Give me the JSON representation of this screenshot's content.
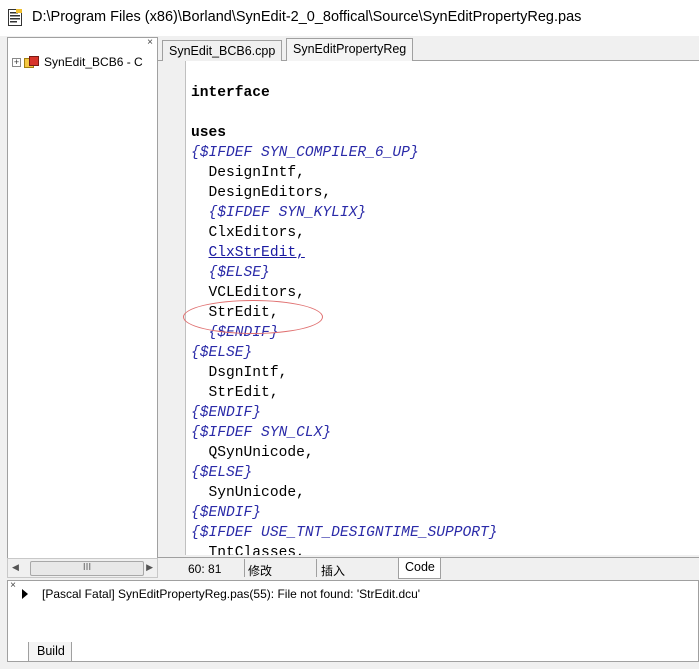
{
  "window": {
    "title": "D:\\Program Files (x86)\\Borland\\SynEdit-2_0_8offical\\Source\\SynEditPropertyReg.pas"
  },
  "project_tree": {
    "close_glyph": "×",
    "items": [
      {
        "label": "SynEdit_BCB6 - C",
        "expander": "+",
        "icon": "project-icon"
      }
    ]
  },
  "scrollbar": {
    "left_arrow": "◀",
    "right_arrow": "▶",
    "thumb_grip": "III"
  },
  "tabs": [
    {
      "label": "SynEdit_BCB6.cpp",
      "active": false
    },
    {
      "label": "SynEditPropertyReg",
      "active": true
    }
  ],
  "code_lines": [
    {
      "text": "interface",
      "style": "kw"
    },
    {
      "text": "",
      "style": "id"
    },
    {
      "text": "uses",
      "style": "kw"
    },
    {
      "text": "{$IFDEF SYN_COMPILER_6_UP}",
      "style": "dir"
    },
    {
      "text": "  DesignIntf,",
      "style": "id"
    },
    {
      "text": "  DesignEditors,",
      "style": "id"
    },
    {
      "text": "  {$IFDEF SYN_KYLIX}",
      "style": "dir"
    },
    {
      "text": "  ClxEditors,",
      "style": "id"
    },
    {
      "text": "  ClxStrEdit,",
      "style": "link"
    },
    {
      "text": "  {$ELSE}",
      "style": "dir"
    },
    {
      "text": "  VCLEditors,",
      "style": "id"
    },
    {
      "text": "  StrEdit,",
      "style": "id"
    },
    {
      "text": "  {$ENDIF}",
      "style": "dir"
    },
    {
      "text": "{$ELSE}",
      "style": "dir"
    },
    {
      "text": "  DsgnIntf,",
      "style": "id"
    },
    {
      "text": "  StrEdit,",
      "style": "id"
    },
    {
      "text": "{$ENDIF}",
      "style": "dir"
    },
    {
      "text": "{$IFDEF SYN_CLX}",
      "style": "dir"
    },
    {
      "text": "  QSynUnicode,",
      "style": "id"
    },
    {
      "text": "{$ELSE}",
      "style": "dir"
    },
    {
      "text": "  SynUnicode,",
      "style": "id"
    },
    {
      "text": "{$ENDIF}",
      "style": "dir"
    },
    {
      "text": "{$IFDEF USE_TNT_DESIGNTIME_SUPPORT}",
      "style": "dir"
    },
    {
      "text": "  TntClasses,",
      "style": "id"
    }
  ],
  "status_bar": {
    "position": "60: 81",
    "modified": "修改",
    "insert_mode": "插入",
    "view_tab": "Code"
  },
  "messages": {
    "close_glyph": "×",
    "items": [
      {
        "text": "[Pascal Fatal] SynEditPropertyReg.pas(55): File not found: 'StrEdit.dcu'"
      }
    ],
    "tab": "Build"
  }
}
